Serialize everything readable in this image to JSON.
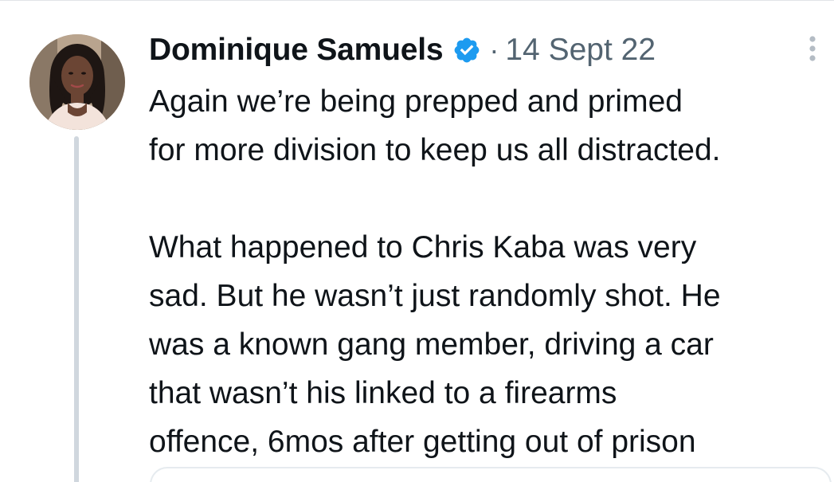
{
  "tweet": {
    "author_name": "Dominique Samuels",
    "separator": "·",
    "date": "14 Sept 22",
    "paragraph_1": "Again we’re being prepped and primed\nfor more division to keep us all distracted.",
    "paragraph_2": "What happened to Chris Kaba was very\nsad. But he wasn’t just randomly shot. He\nwas a known gang member, driving a car\nthat wasn’t his linked to a firearms\noffence, 6mos after getting out of prison"
  },
  "icons": {
    "verified": "verified-badge-icon",
    "more": "more-vertical-icon"
  },
  "colors": {
    "verified_blue": "#1d9bf0",
    "thread_line": "#d0d7de",
    "secondary_text": "#536471",
    "primary_text": "#0f1419"
  }
}
